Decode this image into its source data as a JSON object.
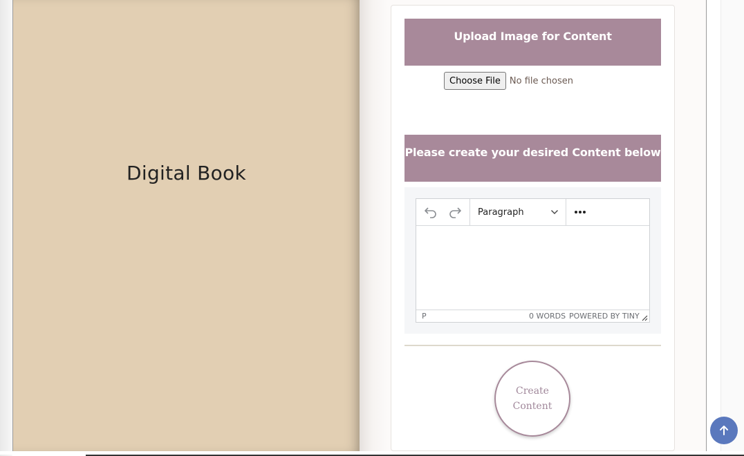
{
  "left_page": {
    "title": "Digital Book"
  },
  "upload": {
    "header": "Upload Image for Content",
    "choose_file_label": "Choose File",
    "file_status": "No file chosen"
  },
  "content": {
    "header": "Please create your desired Content below"
  },
  "editor": {
    "block_format": "Paragraph",
    "status_path": "P",
    "word_count": "0 WORDS",
    "powered_by": "POWERED BY TINY"
  },
  "actions": {
    "create_label": "Create Content"
  },
  "colors": {
    "header_bg": "#a8899a",
    "left_page_bg": "#e2cfb3",
    "scroll_top_bg": "#5a78bd",
    "create_border": "#a7899a"
  },
  "icons": {
    "undo": "undo-icon",
    "redo": "redo-icon",
    "more": "more-icon",
    "chevron": "chevron-down-icon",
    "scroll_top": "arrow-up-icon",
    "resize": "resize-handle-icon"
  }
}
